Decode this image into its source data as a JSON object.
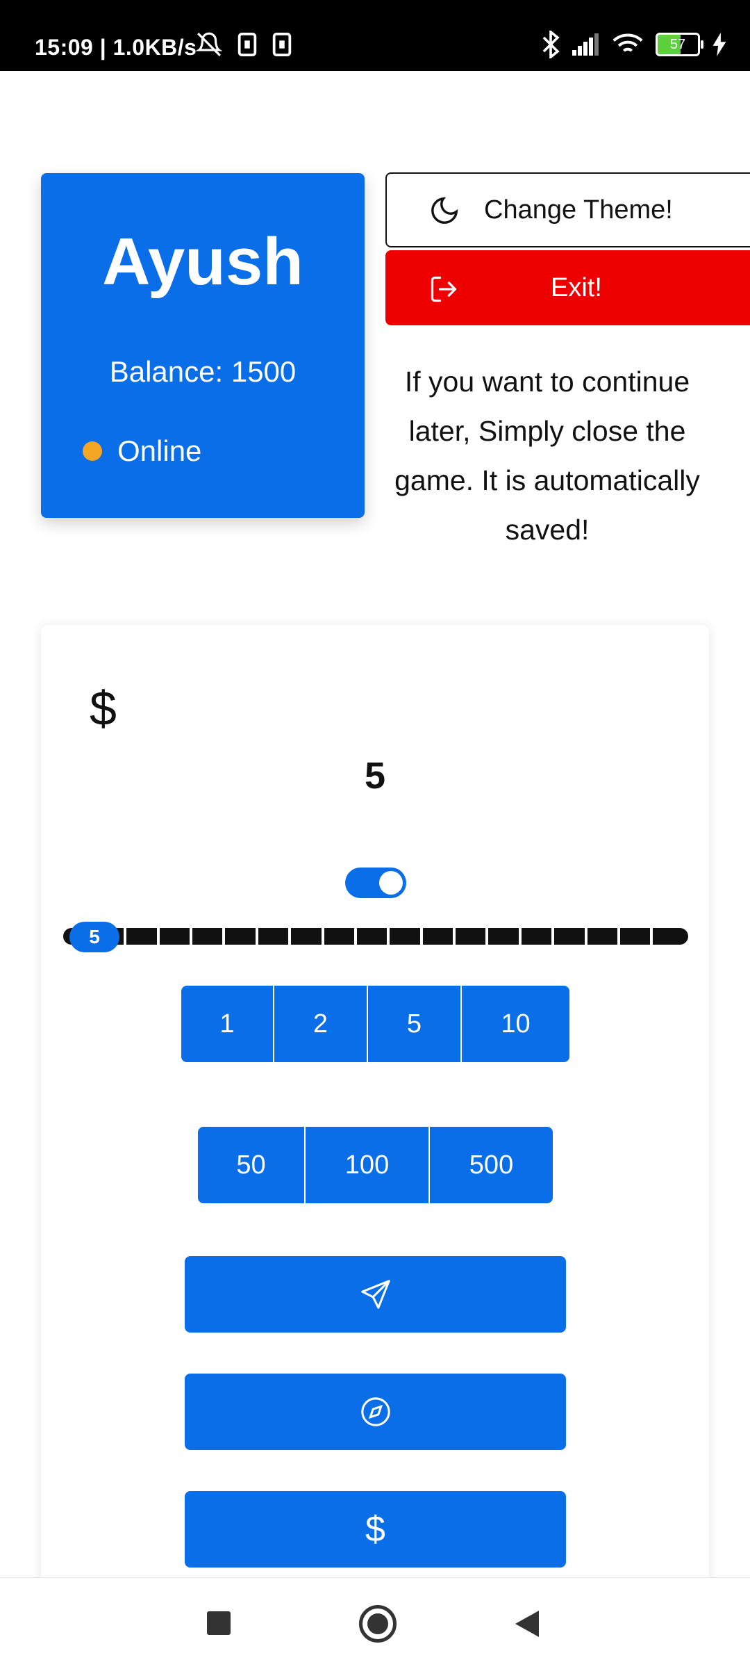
{
  "status_bar": {
    "time_and_speed": "15:09 | 1.0KB/s",
    "battery_level": "57",
    "icons": [
      "mute-icon",
      "notification-icon",
      "notification-icon",
      "bluetooth-icon",
      "signal-icon",
      "wifi-icon",
      "battery-icon",
      "charging-icon"
    ]
  },
  "profile": {
    "name": "Ayush",
    "balance_label": "Balance: 1500",
    "status": "Online",
    "status_color": "#f5a623"
  },
  "actions": {
    "theme_label": "Change Theme!",
    "exit_label": "Exit!"
  },
  "save_note": "If you want to continue later, Simply close the game. It is automatically saved!",
  "bet": {
    "currency_symbol": "$",
    "value": "5",
    "toggle_on": true,
    "slider_value_label": "5",
    "slider_value": 5,
    "chip_row_1": [
      "1",
      "2",
      "5",
      "10"
    ],
    "chip_row_2": [
      "50",
      "100",
      "500"
    ],
    "buttons": [
      {
        "icon": "send-icon"
      },
      {
        "icon": "compass-icon"
      },
      {
        "icon": "dollar-icon",
        "symbol": "$"
      }
    ]
  },
  "colors": {
    "primary": "#0a6ee8",
    "danger": "#ee0000",
    "status_online": "#f5a623"
  }
}
